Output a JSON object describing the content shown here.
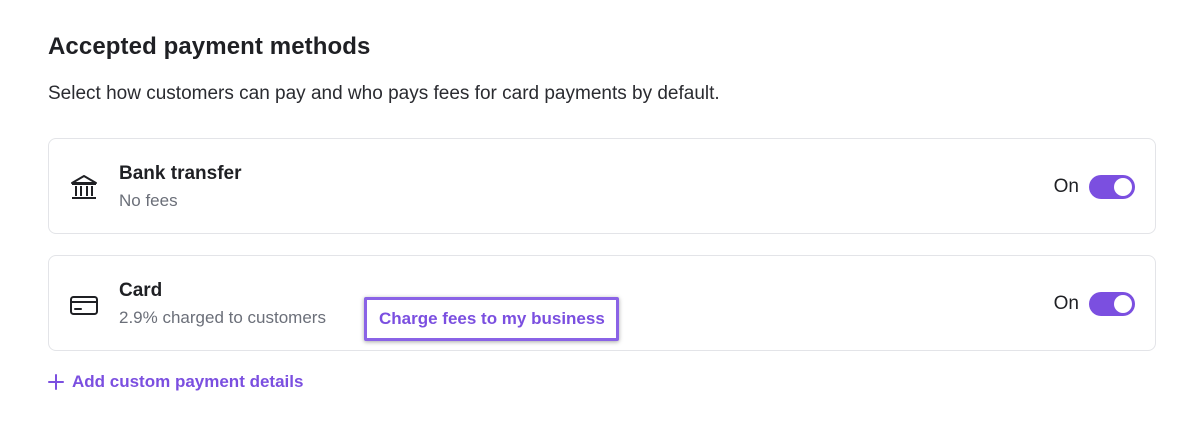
{
  "section": {
    "title": "Accepted payment methods",
    "subtitle": "Select how customers can pay and who pays fees for card payments by default."
  },
  "methods": [
    {
      "name": "Bank transfer",
      "description": "No fees",
      "toggle_label": "On",
      "enabled": true,
      "icon": "bank-icon"
    },
    {
      "name": "Card",
      "description": "2.9% charged to customers",
      "toggle_label": "On",
      "enabled": true,
      "icon": "credit-card-icon",
      "link": "Charge fees to my business"
    }
  ],
  "add_custom": {
    "label": "Add custom payment details",
    "icon": "plus-icon"
  },
  "colors": {
    "accent": "#7b4fe0",
    "muted_text": "#6b6f79",
    "border": "#e3e4e8"
  }
}
